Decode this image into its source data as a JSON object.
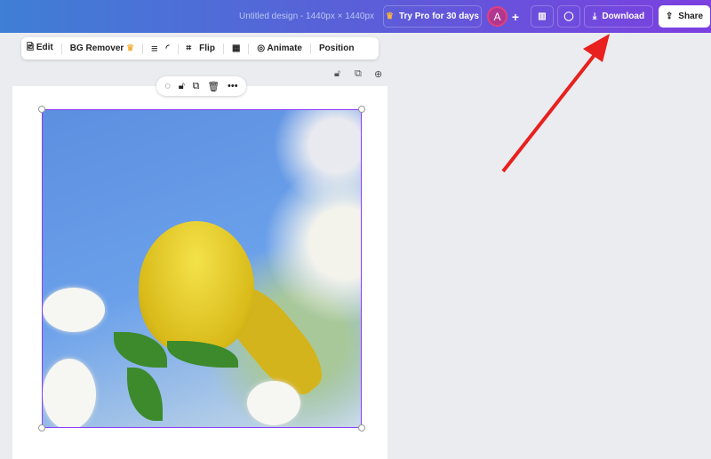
{
  "header": {
    "title": "Untitled design - 1440px × 1440px",
    "try_pro": "Try Pro for 30 days",
    "avatar": "A",
    "plus": "+",
    "download": "Download",
    "share": "Share"
  },
  "toolbar": {
    "edit": "Edit",
    "bg_remover": "BG Remover",
    "flip": "Flip",
    "animate": "Animate",
    "position": "Position"
  },
  "colors": {
    "accent": "#8b3dff",
    "arrow": "#e8201e"
  }
}
